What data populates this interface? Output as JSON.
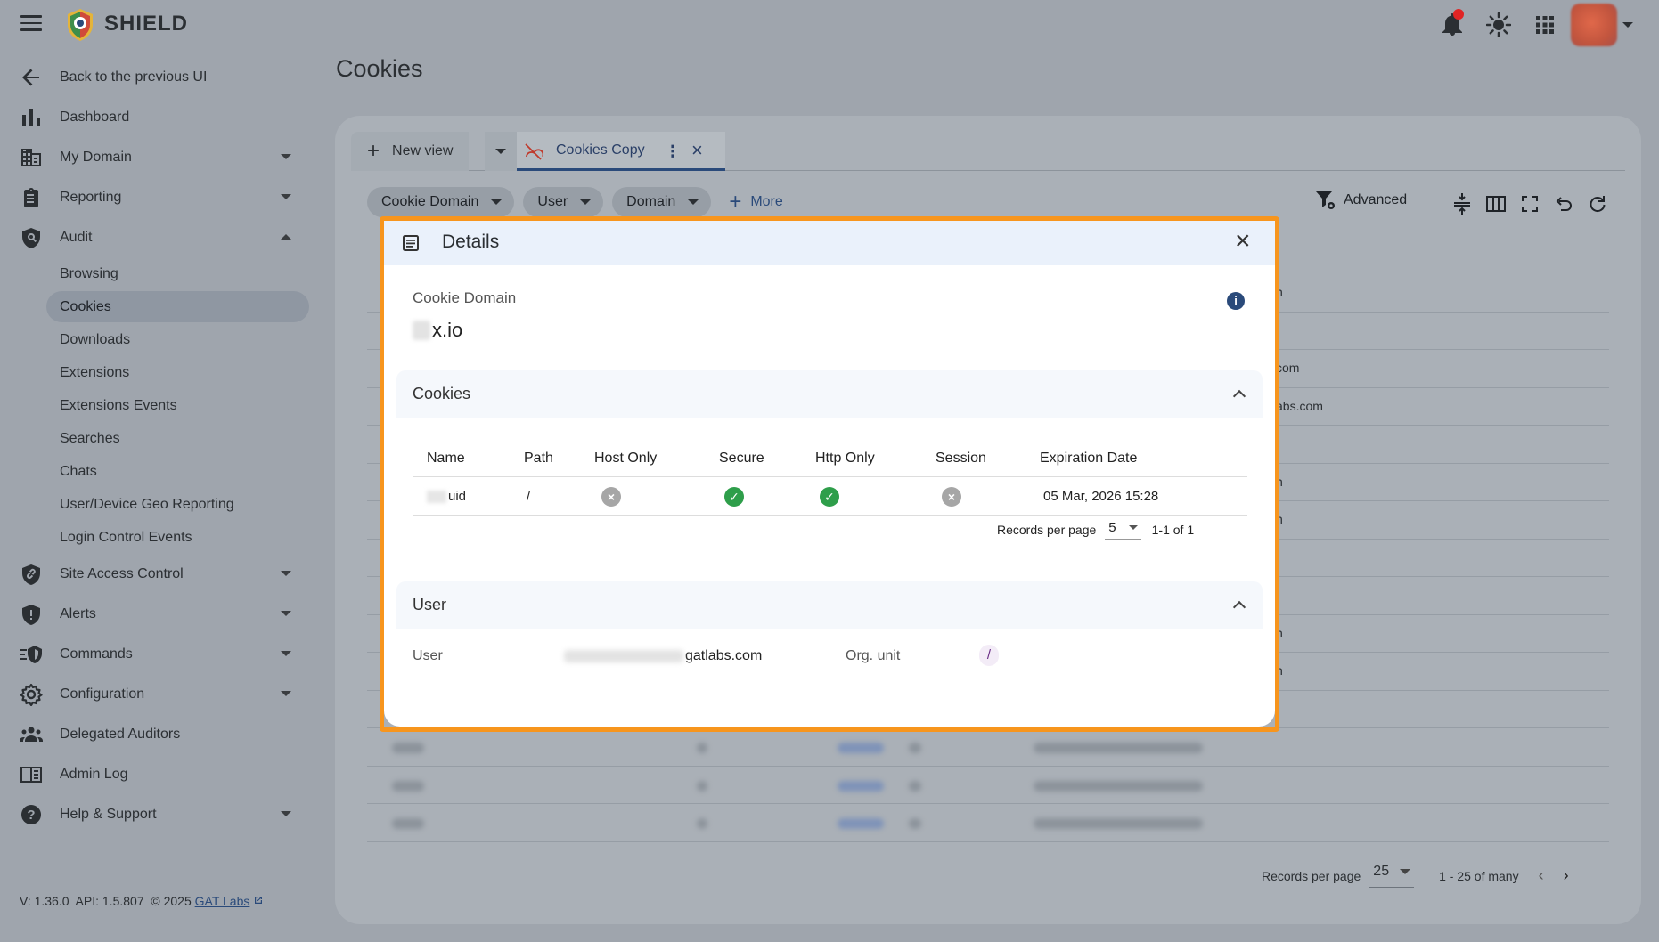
{
  "app": {
    "brand": "SHIELD"
  },
  "header": {
    "icons": [
      "menu-icon",
      "bell-icon",
      "brightness-icon",
      "apps-grid-icon",
      "avatar"
    ]
  },
  "sidebar": {
    "back": "Back to the previous UI",
    "items": [
      {
        "label": "Dashboard",
        "icon": "bar-chart-icon"
      },
      {
        "label": "My Domain",
        "icon": "building-icon",
        "expandable": true
      },
      {
        "label": "Reporting",
        "icon": "clipboard-icon",
        "expandable": true
      },
      {
        "label": "Audit",
        "icon": "audit-search-icon",
        "expanded": true
      },
      {
        "label": "Site Access Control",
        "icon": "shield-link-icon",
        "expandable": true
      },
      {
        "label": "Alerts",
        "icon": "alert-shield-icon",
        "expandable": true
      },
      {
        "label": "Commands",
        "icon": "commands-icon",
        "expandable": true
      },
      {
        "label": "Configuration",
        "icon": "gear-icon",
        "expandable": true
      },
      {
        "label": "Delegated Auditors",
        "icon": "people-icon"
      },
      {
        "label": "Admin Log",
        "icon": "log-icon"
      },
      {
        "label": "Help & Support",
        "icon": "help-icon",
        "expandable": true
      }
    ],
    "audit_sub": [
      "Browsing",
      "Cookies",
      "Downloads",
      "Extensions",
      "Extensions Events",
      "Searches",
      "Chats",
      "User/Device Geo Reporting",
      "Login Control Events"
    ],
    "active_sub": "Cookies",
    "footer": {
      "version": "V: 1.36.0",
      "api": "API: 1.5.807",
      "copyright": "© 2025",
      "link": "GAT Labs"
    }
  },
  "main": {
    "title": "Cookies",
    "tabs": {
      "new_view": "New view",
      "active": "Cookies Copy"
    },
    "filters": [
      "Cookie Domain",
      "User",
      "Domain"
    ],
    "more": "More",
    "advanced": "Advanced",
    "bg_fragments": [
      "n",
      "",
      "com",
      "abs.com",
      "",
      "n",
      "n",
      "",
      "",
      "n",
      "n",
      "",
      "",
      "",
      ""
    ],
    "pagination": {
      "records_label": "Records per page",
      "per_page": "25",
      "range": "1 - 25 of many"
    }
  },
  "modal": {
    "title": "Details",
    "cookie_domain_label": "Cookie Domain",
    "cookie_domain_value": "x.io",
    "cookies_section": "Cookies",
    "columns": [
      "Name",
      "Path",
      "Host Only",
      "Secure",
      "Http Only",
      "Session",
      "Expiration Date"
    ],
    "row": {
      "name": "uid",
      "path": "/",
      "host_only": false,
      "secure": true,
      "http_only": true,
      "session": false,
      "expiration": "05 Mar, 2026 15:28"
    },
    "pagination": {
      "records_label": "Records per page",
      "per_page": "5",
      "range": "1-1 of 1"
    },
    "user_section": "User",
    "user_label": "User",
    "user_value": "gatlabs.com",
    "org_label": "Org. unit",
    "org_value": "/"
  },
  "colors": {
    "highlight": "#f7951d",
    "accent": "#2a4a7a",
    "check": "#2e9e4a",
    "cross": "#a6a6a6"
  }
}
